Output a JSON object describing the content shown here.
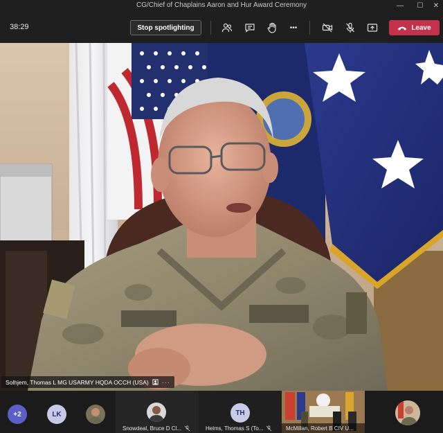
{
  "window": {
    "title": "CG/Chief of Chaplains Aaron and Hur Award Ceremony",
    "minimize_glyph": "—",
    "maximize_glyph": "☐",
    "close_glyph": "✕"
  },
  "toolbar": {
    "timer": "38:29",
    "stop_spotlight_label": "Stop spotlighting",
    "icons": [
      "participants-icon",
      "chat-icon",
      "raise-hand-icon",
      "more-actions-icon",
      "camera-off-icon",
      "mic-off-icon",
      "share-icon"
    ],
    "more_glyph": "•••",
    "leave_label": "Leave",
    "leave_color": "#c4314b"
  },
  "spotlight": {
    "name": "Solhjem, Thomas L MG USARMY HQDA OCCH (USA)",
    "more_glyph": "···"
  },
  "participants": {
    "overflow_badge": "+2",
    "lk_initials": "LK",
    "th_initials": "TH",
    "snowdeal_name": "Snowdeal, Bruce D Cl...",
    "helms_name": "Helms, Thomas S (To...",
    "mcmillan_name": "McMillan, Robert B CIV U..."
  },
  "colors": {
    "accent": "#5b5fc7",
    "background": "#1f1f1f"
  }
}
